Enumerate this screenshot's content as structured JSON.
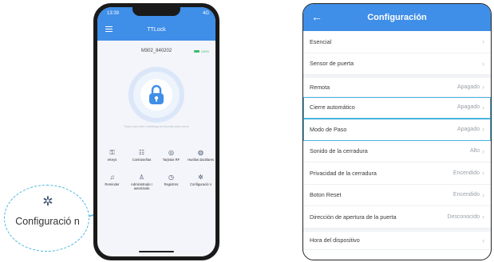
{
  "phone": {
    "status_time": "13:39",
    "status_right": "4G",
    "app_title": "TTLock",
    "lock_name": "M302_840202",
    "battery_text": "100%",
    "hint": "Toque para abrir, mantenga presionado para cerrar",
    "grid": [
      {
        "label": "eKeys",
        "icon": "key-icon",
        "glyph": "⚿"
      },
      {
        "label": "Contraseñas",
        "icon": "password-icon",
        "glyph": "☷"
      },
      {
        "label": "Tarjetas RF",
        "icon": "card-icon",
        "glyph": "◎"
      },
      {
        "label": "Huellas dactilares",
        "icon": "fingerprint-icon",
        "glyph": "◍"
      },
      {
        "label": "Reminder",
        "icon": "bell-icon",
        "glyph": "♫"
      },
      {
        "label": "Administrado r autorizado",
        "icon": "admin-icon",
        "glyph": "♙"
      },
      {
        "label": "Registros",
        "icon": "clock-icon",
        "glyph": "◷"
      },
      {
        "label": "Configuració n",
        "icon": "gear-icon",
        "glyph": "✲"
      }
    ]
  },
  "callout": {
    "label": "Configuració n",
    "icon": "gear-icon",
    "color": "#47b4e0"
  },
  "settings": {
    "title": "Configuración",
    "accent": "#3f8ee8",
    "rows": [
      {
        "label": "Esencial",
        "value": ""
      },
      {
        "label": "Sensor de puerta",
        "value": ""
      },
      {
        "label": "Remota",
        "value": "Apagado"
      },
      {
        "label": "Cierre automático",
        "value": "Apagado"
      },
      {
        "label": "Modo de Paso",
        "value": "Apagado"
      },
      {
        "label": "Sonido de la cerradura",
        "value": "Alto"
      },
      {
        "label": "Privacidad de la cerradura",
        "value": "Encendido"
      },
      {
        "label": "Boton Reset",
        "value": "Encendido"
      },
      {
        "label": "Dirección de apertura de la puerta",
        "value": "Desconocido"
      },
      {
        "label": "Hora del dispositivo",
        "value": ""
      }
    ]
  }
}
